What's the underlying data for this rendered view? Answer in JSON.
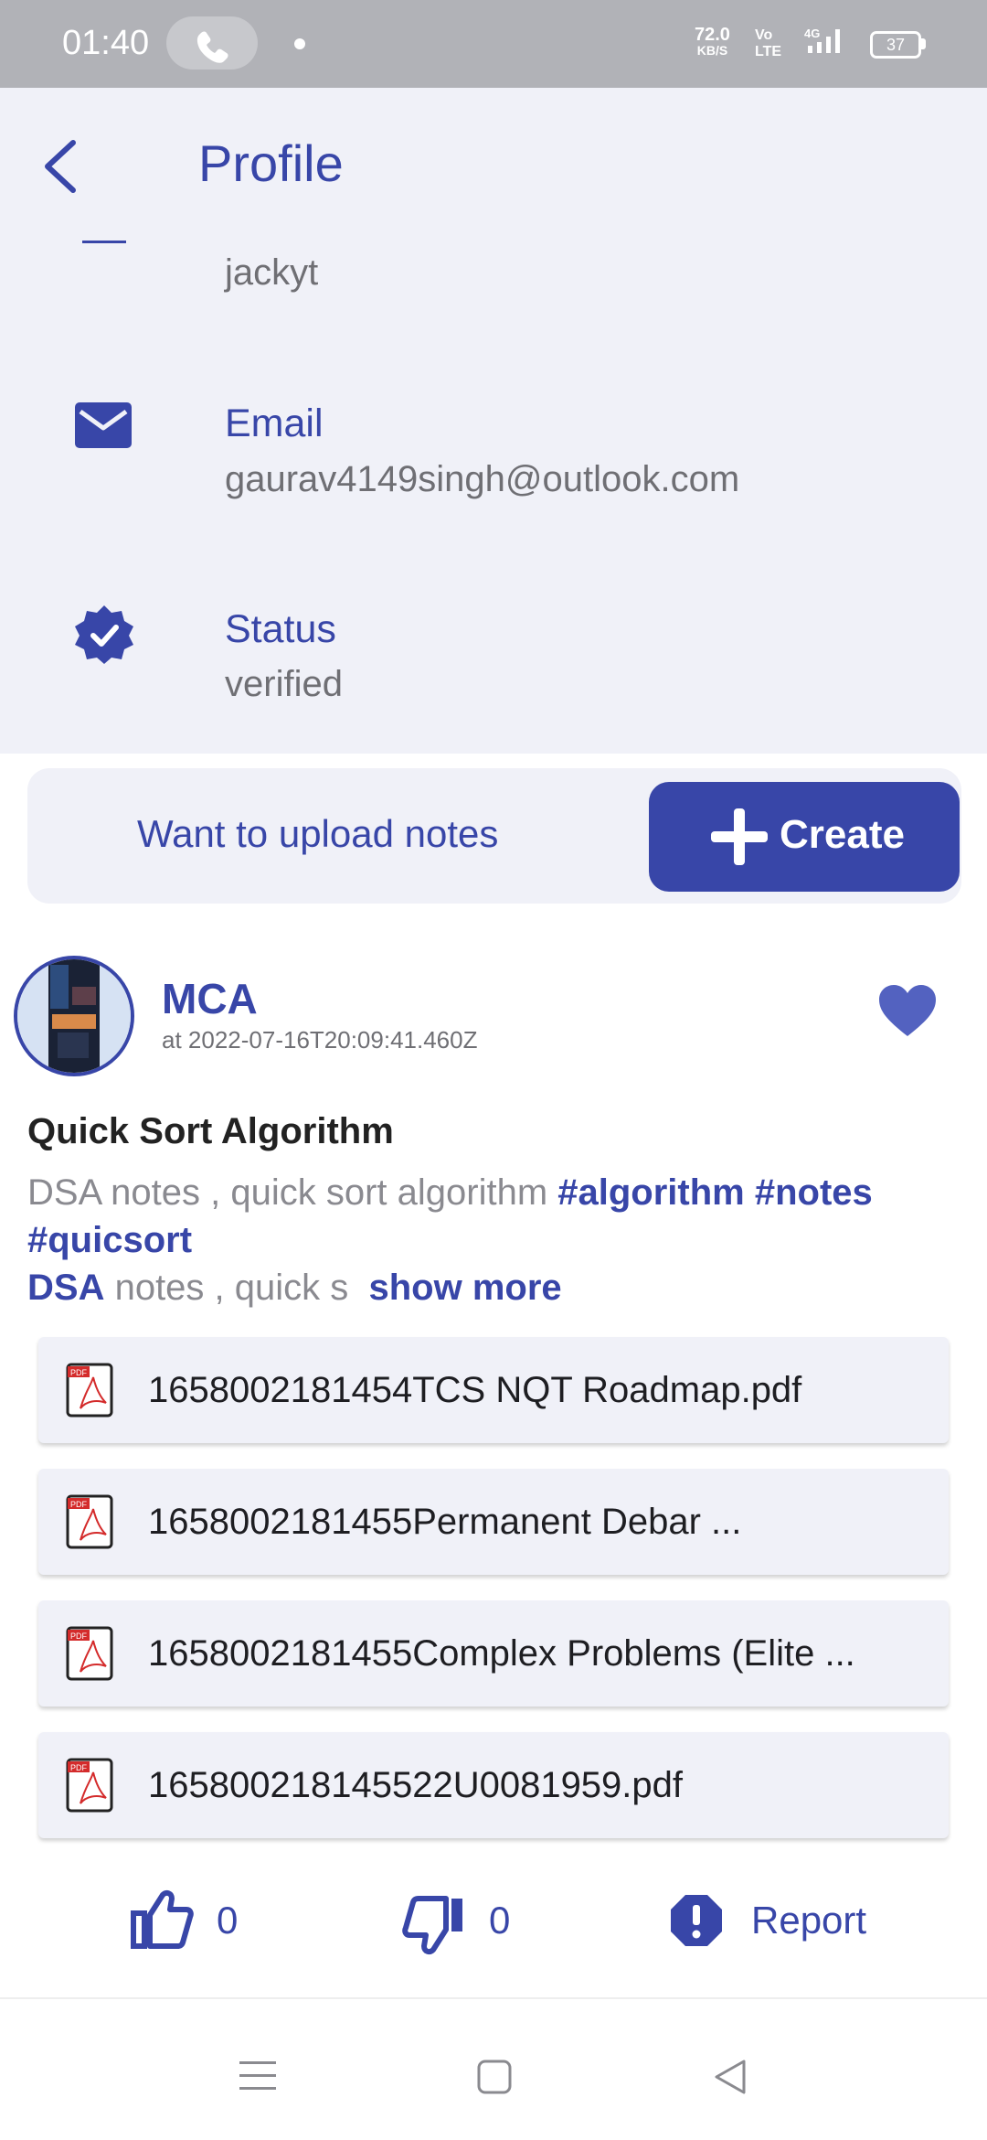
{
  "status_bar": {
    "time": "01:40",
    "net_speed": "72.0",
    "net_unit": "KB/S",
    "volte": "Vo LTE",
    "signal": "4G",
    "battery": "37"
  },
  "header": {
    "title": "Profile",
    "back_icon": "chevron-left-icon"
  },
  "profile": {
    "username_value": "jackyt",
    "email_label": "Email",
    "email_value": "gaurav4149singh@outlook.com",
    "status_label": "Status",
    "status_value": "verified"
  },
  "upload": {
    "prompt": "Want to upload notes",
    "create_label": "Create"
  },
  "post": {
    "user": "MCA",
    "date": "at 2022-07-16T20:09:41.460Z",
    "title": "Quick Sort Algorithm",
    "desc_text": "DSA notes , quick sort algorithm",
    "tags": [
      "#algorithm",
      "#notes",
      "#quicsort"
    ],
    "desc2_tag": "DSA",
    "desc2_text": "notes , quick s",
    "show_more": "show more",
    "files": [
      "1658002181454TCS NQT Roadmap.pdf",
      "1658002181455Permanent Debar ...",
      "1658002181455Complex Problems (Elite ...",
      "165800218145522U0081959.pdf"
    ],
    "likes": "0",
    "dislikes": "0",
    "report_label": "Report"
  },
  "colors": {
    "accent": "#3846a8",
    "surface": "#f0f1f8",
    "statusbar": "#b1b2b7"
  }
}
